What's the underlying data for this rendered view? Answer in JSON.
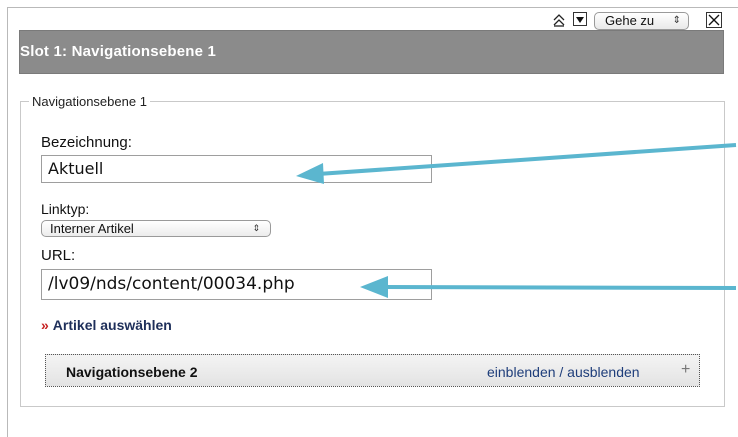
{
  "slot": {
    "title": "Slot 1: Navigationsebene 1",
    "goto_label": "Gehe zu",
    "goto_arrows": "⇕",
    "icon_up": "double-chevron-up-icon",
    "icon_down": "dropdown-toggle-icon",
    "icon_close": "close-icon"
  },
  "level1": {
    "legend": "Navigationsebene 1",
    "bezeichnung_label": "Bezeichnung:",
    "bezeichnung_value": "Aktuell",
    "linktyp_label": "Linktyp:",
    "linktyp_value": "Interner Artikel",
    "linktyp_arrows": "⇕",
    "url_label": "URL:",
    "url_value": "/lv09/nds/content/00034.php",
    "choose_article": "Artikel auswählen",
    "choose_chevron": "»"
  },
  "level2": {
    "title": "Navigationsebene 2",
    "toggle_label": "einblenden / ausblenden",
    "plus": "+"
  },
  "colors": {
    "header_bg": "#8b8b8b",
    "arrow_color": "#5bb6cf",
    "link_color": "#1e2f5a",
    "chevron_color": "#c62020"
  }
}
